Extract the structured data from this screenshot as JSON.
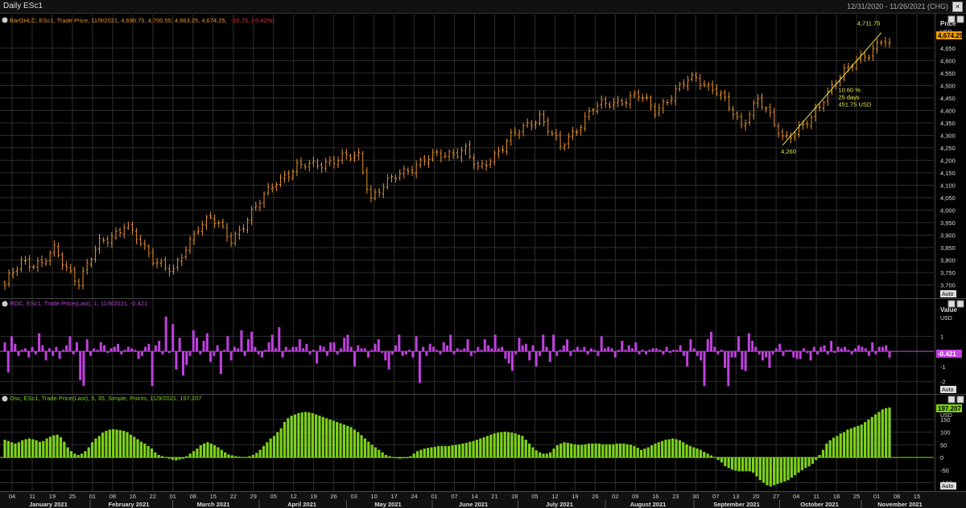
{
  "window": {
    "title": "Daily ESc1",
    "range": "12/31/2020 - 11/26/2021 (CHG)"
  },
  "colors": {
    "bar": "#e8922a",
    "roc": "#c040e0",
    "osc": "#7ed11a",
    "price_tag": "#f0a000",
    "grid": "#2e2e2e",
    "bg": "#000000",
    "trend": "#e8e84a"
  },
  "panels": {
    "price": {
      "legend": "BarOHLC, ESc1, Trade Price, 11/9/2021, 4,690.75, 4,700.50, 4,663.25, 4,674.25,",
      "legend_change": "-10.75, (-0.42%)",
      "axis_title": "Price",
      "axis_unit": "USD",
      "last_tag": "4,674.25",
      "auto_label": "Auto",
      "ticks": [
        "3,700",
        "3,750",
        "3,800",
        "3,850",
        "3,900",
        "3,950",
        "4,000",
        "4,050",
        "4,100",
        "4,150",
        "4,200",
        "4,250",
        "4,300",
        "4,350",
        "4,400",
        "4,450",
        "4,500",
        "4,550",
        "4,600",
        "4,650"
      ],
      "tick_values": [
        3700,
        3750,
        3800,
        3850,
        3900,
        3950,
        4000,
        4050,
        4100,
        4150,
        4200,
        4250,
        4300,
        4350,
        4400,
        4450,
        4500,
        4550,
        4600,
        4650
      ],
      "ylim": [
        3650,
        4730
      ],
      "annotation": {
        "high_label": "4,711.75",
        "low_label": "4,260",
        "pct": "10.60 %",
        "days": "25 days",
        "diff": "451.75 USD"
      }
    },
    "roc": {
      "legend": "ROC, ESc1, Trade Price(Last), 1, 11/9/2021, -0.421",
      "axis_title": "Value",
      "axis_unit": "USD",
      "last_tag": "-0.421",
      "auto_label": "Auto",
      "ticks": [
        "1",
        "0",
        "-1",
        "-2"
      ],
      "tick_values": [
        1,
        0,
        -1,
        -2
      ],
      "ylim": [
        -2.6,
        2.4
      ]
    },
    "osc": {
      "legend": "Osc, ESc1, Trade Price(Last), 5, 35, Simple, Points, 11/9/2021, 197.207",
      "axis_unit": "USD",
      "last_tag": "197.207",
      "auto_label": "Auto",
      "ticks": [
        "150",
        "100",
        "50",
        "0",
        "-50",
        "-100"
      ],
      "tick_values": [
        150,
        100,
        50,
        0,
        -50,
        -100
      ],
      "ylim": [
        -130,
        210
      ]
    }
  },
  "x_axis": {
    "days": [
      "04",
      "11",
      "19",
      "25",
      "01",
      "08",
      "16",
      "22",
      "01",
      "08",
      "15",
      "22",
      "29",
      "05",
      "12",
      "19",
      "26",
      "03",
      "10",
      "17",
      "24",
      "01",
      "07",
      "14",
      "21",
      "28",
      "05",
      "12",
      "19",
      "26",
      "02",
      "09",
      "16",
      "23",
      "30",
      "07",
      "13",
      "20",
      "27",
      "04",
      "11",
      "18",
      "25",
      "01",
      "08",
      "15",
      "22"
    ],
    "months": [
      "January 2021",
      "February 2021",
      "March 2021",
      "April 2021",
      "May 2021",
      "June 2021",
      "July 2021",
      "August 2021",
      "September 2021",
      "October 2021",
      "November 2021"
    ]
  },
  "chart_data": [
    {
      "type": "ohlc",
      "title": "BarOHLC, ESc1, Trade Price",
      "x_range": [
        "2021-01-04",
        "2021-11-09"
      ],
      "ylim": [
        3650,
        4730
      ],
      "close_anchors": [
        [
          "2021-01-04",
          3700
        ],
        [
          "2021-01-08",
          3800
        ],
        [
          "2021-01-15",
          3780
        ],
        [
          "2021-01-21",
          3840
        ],
        [
          "2021-01-29",
          3710
        ],
        [
          "2021-02-05",
          3870
        ],
        [
          "2021-02-12",
          3920
        ],
        [
          "2021-02-16",
          3940
        ],
        [
          "2021-02-25",
          3810
        ],
        [
          "2021-03-04",
          3750
        ],
        [
          "2021-03-12",
          3940
        ],
        [
          "2021-03-17",
          3970
        ],
        [
          "2021-03-24",
          3880
        ],
        [
          "2021-04-01",
          4010
        ],
        [
          "2021-04-09",
          4120
        ],
        [
          "2021-04-16",
          4170
        ],
        [
          "2021-04-29",
          4200
        ],
        [
          "2021-05-07",
          4220
        ],
        [
          "2021-05-12",
          4050
        ],
        [
          "2021-05-21",
          4150
        ],
        [
          "2021-06-04",
          4220
        ],
        [
          "2021-06-15",
          4240
        ],
        [
          "2021-06-18",
          4160
        ],
        [
          "2021-06-30",
          4290
        ],
        [
          "2021-07-12",
          4380
        ],
        [
          "2021-07-19",
          4250
        ],
        [
          "2021-07-29",
          4410
        ],
        [
          "2021-08-13",
          4460
        ],
        [
          "2021-08-19",
          4400
        ],
        [
          "2021-08-31",
          4520
        ],
        [
          "2021-09-02",
          4530
        ],
        [
          "2021-09-10",
          4480
        ],
        [
          "2021-09-20",
          4340
        ],
        [
          "2021-09-24",
          4450
        ],
        [
          "2021-10-04",
          4290
        ],
        [
          "2021-10-13",
          4360
        ],
        [
          "2021-10-21",
          4530
        ],
        [
          "2021-11-02",
          4630
        ],
        [
          "2021-11-05",
          4690
        ],
        [
          "2021-11-09",
          4674.25
        ]
      ],
      "markers": {
        "low": 4260,
        "high": 4711.75,
        "change_pct": 10.6,
        "days": 25,
        "change_usd": 451.75
      }
    },
    {
      "type": "bar",
      "title": "ROC, ESc1, Trade Price(Last), 1",
      "ylim": [
        -2.6,
        2.4
      ],
      "values": [
        0.6,
        -1.4,
        1.0,
        0.5,
        -0.3,
        0.1,
        0.2,
        -0.4,
        0.3,
        -0.2,
        1.2,
        0.4,
        -0.6,
        0.2,
        -0.3,
        0.3,
        -0.5,
        0.1,
        0.4,
        1.0,
        -0.2,
        0.6,
        -1.9,
        -2.3,
        0.8,
        -0.3,
        0.2,
        0.1,
        0.6,
        0.4,
        -0.1,
        0.2,
        0.3,
        0.5,
        -0.2,
        0.1,
        0.3,
        0.2,
        0.1,
        -0.5,
        -0.3,
        0.3,
        0.5,
        -2.3,
        0.4,
        0.7,
        -0.2,
        2.3,
        -0.1,
        1.8,
        -1.2,
        0.9,
        -1.6,
        -0.9,
        -0.3,
        1.4,
        0.9,
        -0.2,
        0.7,
        1.2,
        -0.7,
        -0.3,
        0.4,
        -1.5,
        0.1,
        1.0,
        -0.6,
        0.3,
        0.2,
        1.4,
        -0.3,
        0.8,
        1.3,
        0.3,
        -0.2,
        -0.4,
        0.1,
        0.6,
        1.1,
        0.2,
        1.6,
        -0.4,
        0.3,
        0.1,
        0.3,
        0.3,
        0.8,
        0.2,
        0.5,
        -0.2,
        0.1,
        -0.8,
        0.4,
        0.3,
        -0.3,
        0.6,
        0.6,
        -0.2,
        0.2,
        0.9,
        1.1,
        0.3,
        -1.0,
        0.4,
        0.2,
        0.2,
        -0.4,
        0.1,
        0.5,
        0.8,
        -0.1,
        -0.6,
        -1.2,
        -0.2,
        0.4,
        1.1,
        -0.3,
        -0.2,
        0.1,
        -0.4,
        1.0,
        -2.1,
        0.3,
        -0.3,
        0.5,
        0.3,
        0.1,
        -0.2,
        0.6,
        0.4,
        1.1,
        -0.2,
        0.2,
        0.1,
        0.2,
        0.8,
        -0.3,
        -0.1,
        0.3,
        0.1,
        0.8,
        0.4,
        0.2,
        1.1,
        0.2,
        0.3,
        -0.5,
        -0.8,
        -1.3,
        -0.2,
        0.9,
        0.4,
        0.5,
        -0.6,
        0.4,
        -1.0,
        -0.3,
        1.1,
        0.3,
        -0.7,
        1.1,
        -0.3,
        0.1,
        0.4,
        0.8,
        -0.3,
        0.1,
        0.3,
        0.1,
        0.3,
        -0.2,
        0.2,
        0.1,
        -0.3,
        1.0,
        0.2,
        0.3,
        0.2,
        -0.4,
        0.1,
        0.7,
        0.1,
        0.4,
        0.2,
        0.6,
        -0.2,
        0.1,
        -0.2,
        0.1,
        0.2,
        0.2,
        0.1,
        -0.2,
        0.3,
        -0.1,
        0.1,
        0.1,
        0.4,
        -0.3,
        -1.0,
        0.8,
        0.2,
        -0.3,
        -0.6,
        -2.3,
        0.8,
        1.3,
        0.3,
        -0.2,
        0.1,
        -1.1,
        -2.3,
        -0.4,
        -0.4,
        1.0,
        -1.2,
        -1.3,
        1.2,
        0.7,
        0.3,
        -0.2,
        -0.6,
        -0.4,
        -1.1,
        -0.2,
        0.2,
        0.5,
        -0.3,
        0.1,
        0.1,
        -0.4,
        -0.5,
        -0.5,
        0.2,
        -0.1,
        -0.6,
        0.3,
        -0.2,
        0.3,
        0.4,
        -0.2,
        0.7,
        -0.1,
        0.3,
        0.2,
        0.3,
        0.1,
        -0.2,
        0.2,
        0.4,
        0.3,
        0.2,
        -0.3,
        0.6,
        -0.2,
        0.3,
        0.3,
        0.4,
        -0.421
      ]
    },
    {
      "type": "bar",
      "title": "Osc, ESc1, Trade Price(Last), 5, 35, Simple, Points",
      "ylim": [
        -130,
        210
      ],
      "values": [
        70,
        65,
        60,
        55,
        60,
        68,
        72,
        75,
        72,
        68,
        62,
        65,
        75,
        82,
        88,
        90,
        80,
        62,
        40,
        25,
        15,
        10,
        15,
        25,
        40,
        60,
        75,
        85,
        98,
        105,
        110,
        112,
        110,
        108,
        105,
        100,
        90,
        82,
        72,
        62,
        55,
        45,
        35,
        20,
        10,
        5,
        2,
        -5,
        -10,
        -12,
        -8,
        -5,
        5,
        15,
        25,
        35,
        48,
        55,
        60,
        55,
        48,
        40,
        30,
        20,
        12,
        8,
        5,
        3,
        2,
        2,
        5,
        10,
        18,
        30,
        45,
        60,
        75,
        85,
        100,
        115,
        140,
        155,
        165,
        170,
        175,
        178,
        180,
        178,
        175,
        170,
        165,
        160,
        155,
        150,
        145,
        140,
        135,
        130,
        125,
        120,
        110,
        100,
        88,
        75,
        62,
        50,
        40,
        30,
        20,
        10,
        5,
        2,
        -2,
        -5,
        -3,
        0,
        5,
        15,
        25,
        30,
        35,
        38,
        40,
        42,
        45,
        45,
        45,
        45,
        48,
        50,
        52,
        55,
        58,
        62,
        65,
        70,
        75,
        80,
        85,
        90,
        95,
        98,
        100,
        102,
        100,
        98,
        95,
        90,
        85,
        70,
        55,
        40,
        28,
        20,
        15,
        15,
        20,
        35,
        48,
        55,
        60,
        58,
        55,
        52,
        50,
        50,
        52,
        55,
        55,
        55,
        55,
        52,
        52,
        52,
        52,
        55,
        55,
        55,
        52,
        50,
        45,
        38,
        30,
        35,
        40,
        48,
        55,
        60,
        65,
        70,
        72,
        75,
        72,
        68,
        60,
        52,
        45,
        40,
        35,
        30,
        22,
        15,
        8,
        2,
        -10,
        -20,
        -35,
        -42,
        -48,
        -52,
        -55,
        -55,
        -55,
        -55,
        -60,
        -75,
        -90,
        -100,
        -110,
        -115,
        -110,
        -105,
        -100,
        -95,
        -90,
        -80,
        -70,
        -60,
        -50,
        -42,
        -35,
        -25,
        -10,
        10,
        30,
        55,
        68,
        78,
        85,
        95,
        100,
        110,
        115,
        120,
        125,
        130,
        140,
        150,
        160,
        170,
        180,
        190,
        195,
        197.207
      ]
    }
  ]
}
